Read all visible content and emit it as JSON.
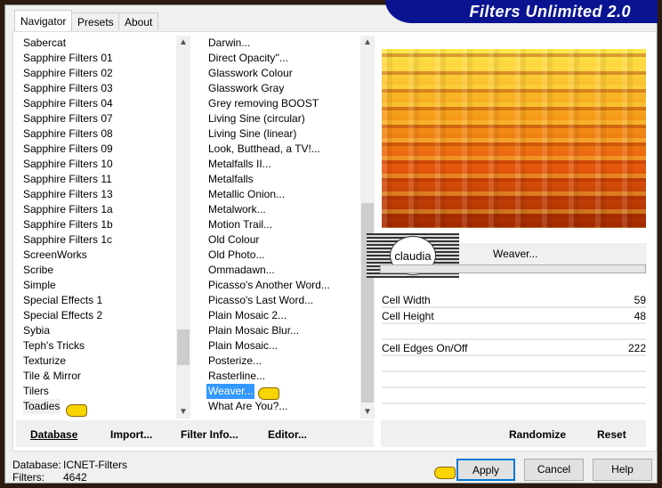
{
  "title": "Filters Unlimited 2.0",
  "tabs": [
    "Navigator",
    "Presets",
    "About"
  ],
  "categories": [
    "Sabercat",
    "Sapphire Filters 01",
    "Sapphire Filters 02",
    "Sapphire Filters 03",
    "Sapphire Filters 04",
    "Sapphire Filters 07",
    "Sapphire Filters 08",
    "Sapphire Filters 09",
    "Sapphire Filters 10",
    "Sapphire Filters 11",
    "Sapphire Filters 13",
    "Sapphire Filters 1a",
    "Sapphire Filters 1b",
    "Sapphire Filters 1c",
    "ScreenWorks",
    "Scribe",
    "Simple",
    "Special Effects 1",
    "Special Effects 2",
    "Sybia",
    "Teph's Tricks",
    "Texturize",
    "Tile & Mirror",
    "Tilers",
    "Toadies"
  ],
  "selected_category": "Toadies",
  "filters": [
    "Darwin...",
    "Direct Opacity''...",
    "Glasswork Colour",
    "Glasswork Gray",
    "Grey removing BOOST",
    "Living Sine (circular)",
    "Living Sine (linear)",
    "Look, Butthead, a TV!...",
    "Metalfalls II...",
    "Metalfalls",
    "Metallic Onion...",
    "Metalwork...",
    "Motion Trail...",
    "Old Colour",
    "Old Photo...",
    "Ommadawn...",
    "Picasso's Another Word...",
    "Picasso's Last Word...",
    "Plain Mosaic 2...",
    "Plain Mosaic Blur...",
    "Plain Mosaic...",
    "Posterize...",
    "Rasterline...",
    "Weaver...",
    "What Are You?..."
  ],
  "selected_filter": "Weaver...",
  "filter_name": "Weaver...",
  "logo_text": "claudia",
  "params": [
    {
      "label": "Cell Width",
      "value": "59"
    },
    {
      "label": "Cell Height",
      "value": "48"
    },
    {
      "label": "Cell Edges On/Off",
      "value": "222"
    }
  ],
  "left_buttons": [
    "Database",
    "Import...",
    "Filter Info...",
    "Editor..."
  ],
  "right_buttons": [
    "Randomize",
    "Reset"
  ],
  "status": {
    "database_label": "Database:",
    "database": "ICNET-Filters",
    "filters_label": "Filters:",
    "filters": "4642"
  },
  "dialog_buttons": {
    "apply": "Apply",
    "cancel": "Cancel",
    "help": "Help"
  },
  "colors": {
    "selection": "#3399ff",
    "banner": "#0a1490"
  }
}
